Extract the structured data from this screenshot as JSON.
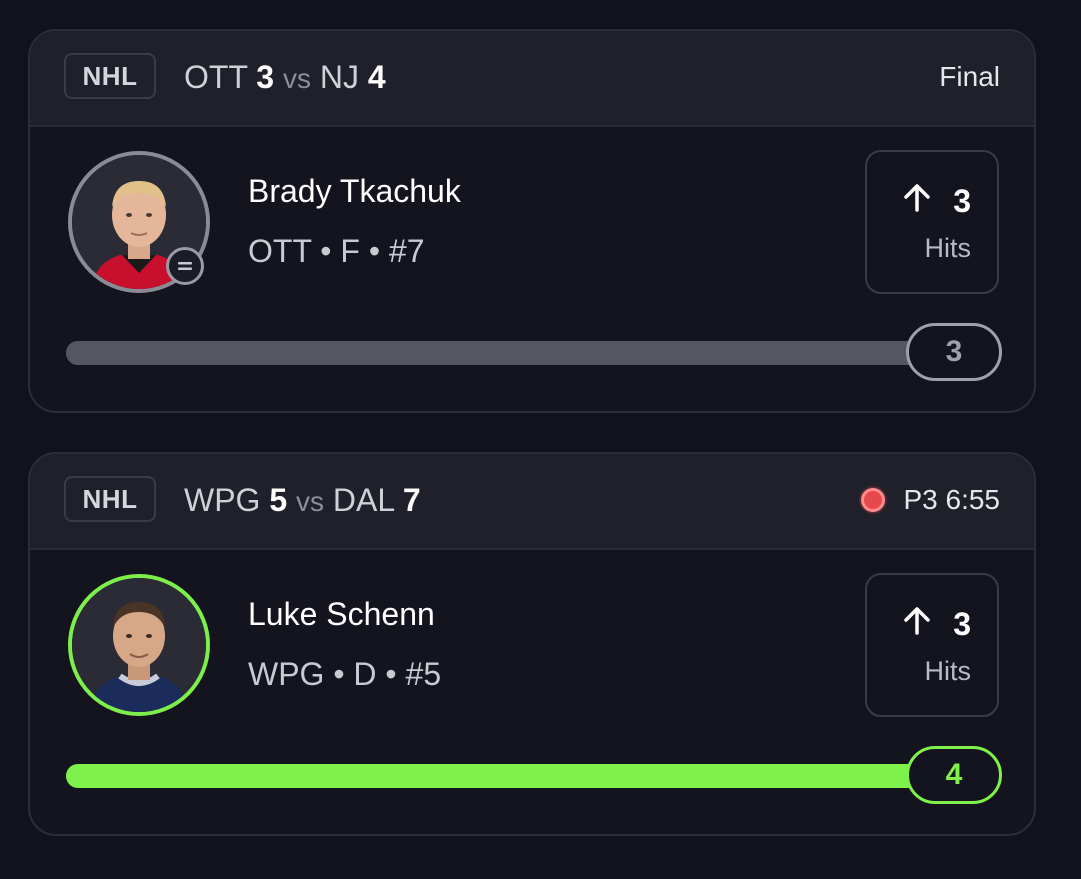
{
  "cards": [
    {
      "league": "NHL",
      "matchup": {
        "team1": "OTT",
        "score1": "3",
        "vs": "vs",
        "team2": "NJ",
        "score2": "4"
      },
      "status": "Final",
      "live": false,
      "player": {
        "name": "Brady Tkachuk",
        "meta": "OTT • F • #7"
      },
      "stat": {
        "value": "3",
        "label": "Hits",
        "icon": "arrow-up-icon"
      },
      "progress": {
        "value": "3",
        "fraction": 1.0,
        "color": "#555660"
      }
    },
    {
      "league": "NHL",
      "matchup": {
        "team1": "WPG",
        "score1": "5",
        "vs": "vs",
        "team2": "DAL",
        "score2": "7"
      },
      "status": "P3 6:55",
      "live": true,
      "player": {
        "name": "Luke Schenn",
        "meta": "WPG • D • #5"
      },
      "stat": {
        "value": "3",
        "label": "Hits",
        "icon": "arrow-up-icon"
      },
      "progress": {
        "value": "4",
        "fraction": 1.0,
        "color": "#7ef24a"
      }
    }
  ]
}
